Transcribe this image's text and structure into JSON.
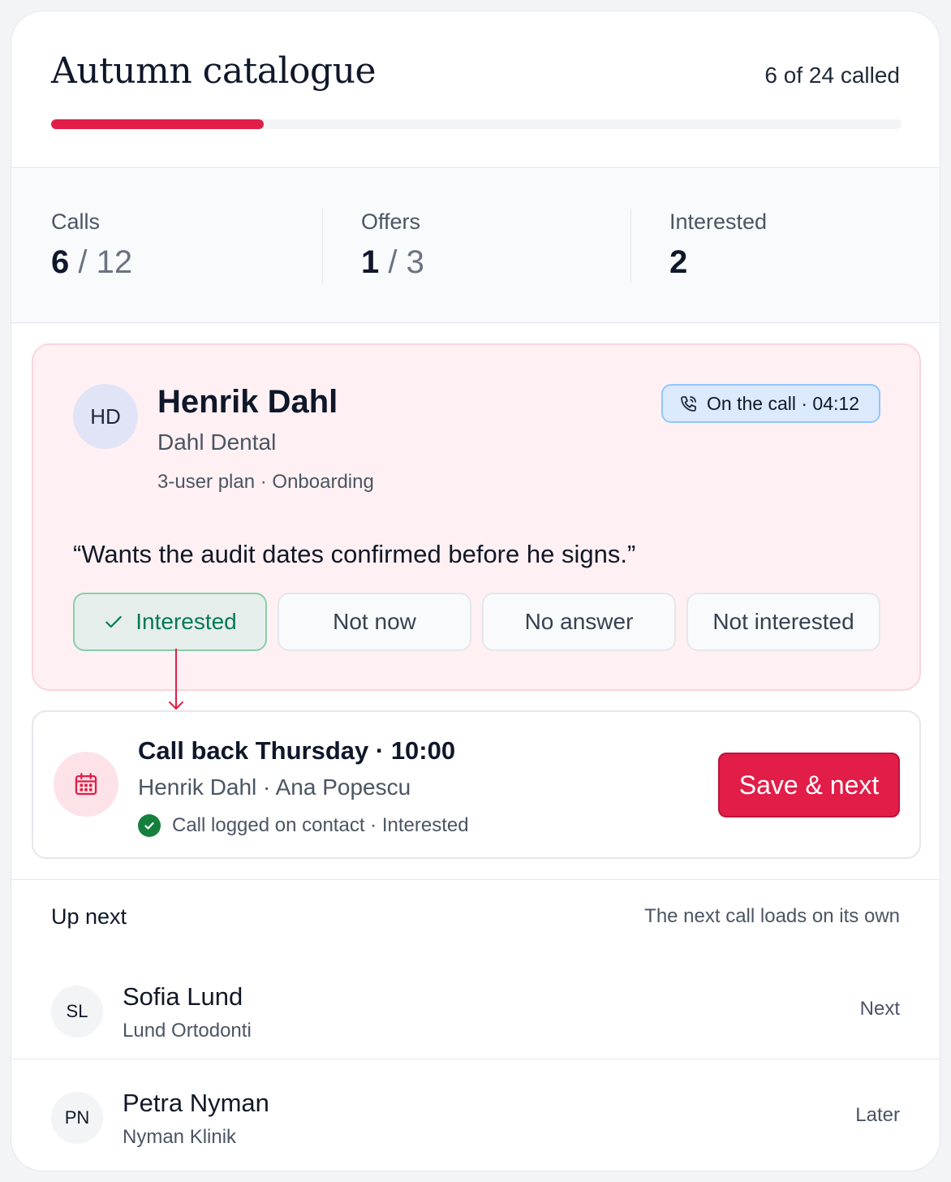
{
  "header": {
    "title": "Autumn catalogue",
    "called_text": "6 of 24 called",
    "progress": 0.25
  },
  "stats": [
    {
      "label": "Calls",
      "value": "6",
      "total": "/ 12"
    },
    {
      "label": "Offers",
      "value": "1",
      "total": "/ 3"
    },
    {
      "label": "Interested",
      "value": "2",
      "total": ""
    }
  ],
  "active_call": {
    "initials": "HD",
    "name": "Henrik Dahl",
    "company": "Dahl Dental",
    "plan": "3-user plan · Onboarding",
    "status": "On the call · 04:12",
    "quote": "“Wants the audit dates confirmed before he signs.”",
    "outcomes": [
      "Interested",
      "Not now",
      "No answer",
      "Not interested"
    ],
    "selected_outcome": "Interested"
  },
  "callback": {
    "title": "Call back Thursday · 10:00",
    "people": "Henrik Dahl · Ana Popescu",
    "logged": "Call logged on contact · Interested",
    "save_label": "Save & next"
  },
  "up_next": {
    "title": "Up next",
    "note": "The next call loads on its own",
    "items": [
      {
        "initials": "SL",
        "name": "Sofia Lund",
        "company": "Lund Ortodonti",
        "status": "Next"
      },
      {
        "initials": "PN",
        "name": "Petra Nyman",
        "company": "Nyman Klinik",
        "status": "Later"
      }
    ]
  },
  "colors": {
    "accent": "#e11d48",
    "selected_green": "#047857",
    "call_badge_blue": "#dbeafe",
    "active_bg": "#fff1f3"
  },
  "icons": {
    "call_status": "phone-icon",
    "selected_outcome": "check-icon",
    "callback": "calendar-icon",
    "logged": "check-circle-icon"
  }
}
